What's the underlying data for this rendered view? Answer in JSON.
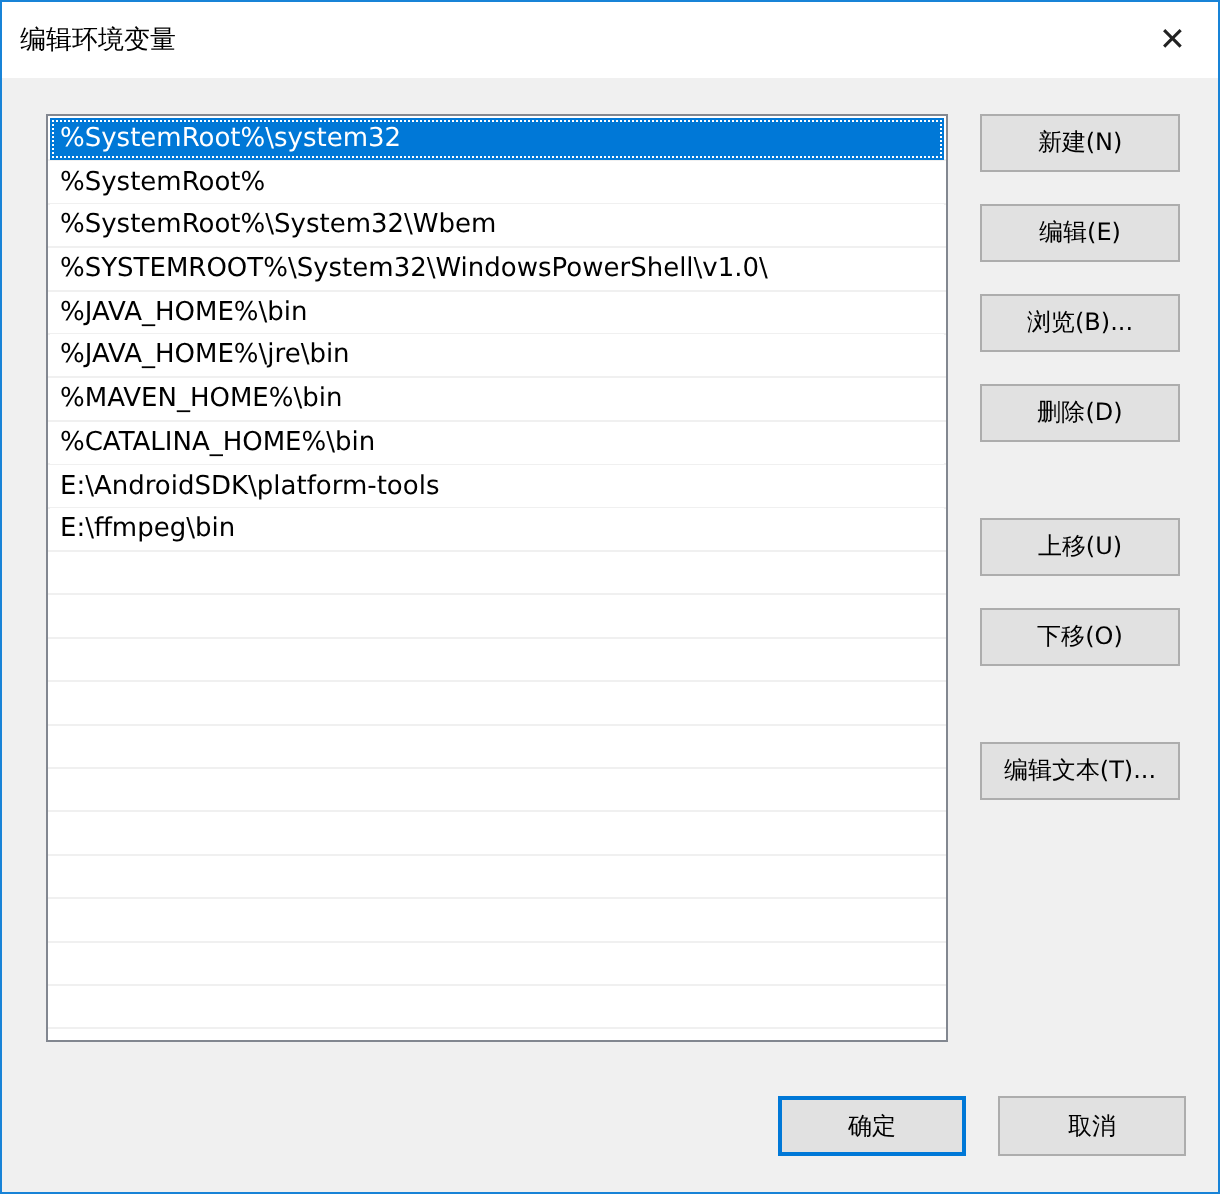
{
  "window": {
    "title": "编辑环境变量",
    "close": "✕"
  },
  "paths": [
    {
      "text": "%SystemRoot%\\system32",
      "selected": true
    },
    {
      "text": "%SystemRoot%",
      "selected": false
    },
    {
      "text": "%SystemRoot%\\System32\\Wbem",
      "selected": false
    },
    {
      "text": "%SYSTEMROOT%\\System32\\WindowsPowerShell\\v1.0\\",
      "selected": false
    },
    {
      "text": "%JAVA_HOME%\\bin",
      "selected": false
    },
    {
      "text": "%JAVA_HOME%\\jre\\bin",
      "selected": false
    },
    {
      "text": "%MAVEN_HOME%\\bin",
      "selected": false
    },
    {
      "text": "%CATALINA_HOME%\\bin",
      "selected": false
    },
    {
      "text": "E:\\AndroidSDK\\platform-tools",
      "selected": false
    },
    {
      "text": "E:\\ffmpeg\\bin",
      "selected": false
    }
  ],
  "side_buttons": [
    [
      {
        "label": "新建(N)"
      },
      {
        "label": "编辑(E)"
      },
      {
        "label": "浏览(B)..."
      },
      {
        "label": "删除(D)"
      }
    ],
    [
      {
        "label": "上移(U)"
      },
      {
        "label": "下移(O)"
      }
    ],
    [
      {
        "label": "编辑文本(T)..."
      }
    ]
  ],
  "footer_buttons": [
    {
      "label": "确定",
      "default": true
    },
    {
      "label": "取消",
      "default": false
    }
  ]
}
